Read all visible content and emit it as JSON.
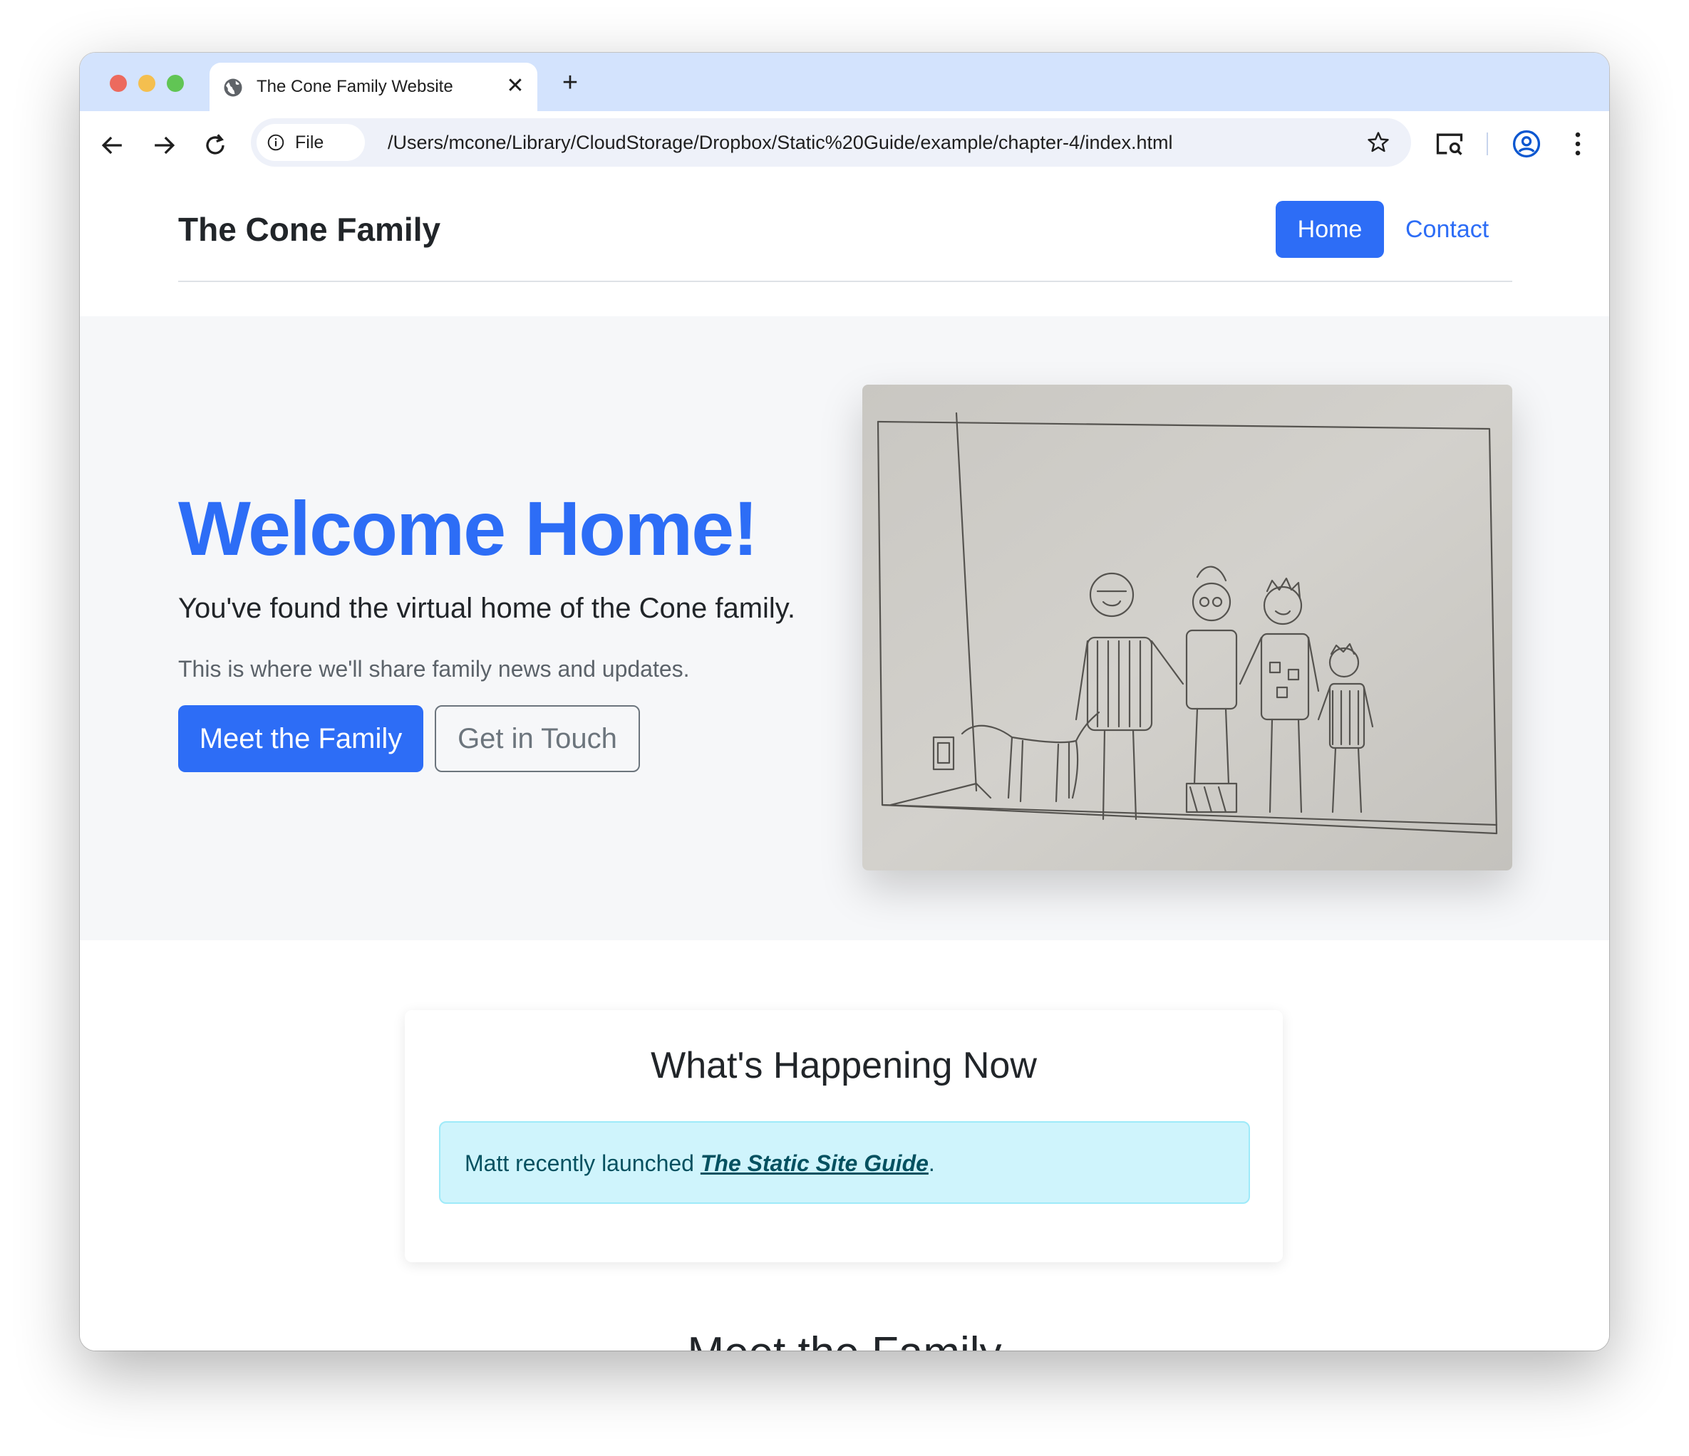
{
  "browser": {
    "tab_title": "The Cone Family Website",
    "site_chip_label": "File",
    "url": "/Users/mcone/Library/CloudStorage/Dropbox/Static%20Guide/example/chapter-4/index.html",
    "tab_close_symbol": "✕",
    "new_tab_symbol": "+"
  },
  "navbar": {
    "brand": "The Cone Family",
    "links": [
      {
        "label": "Home",
        "active": true
      },
      {
        "label": "Contact",
        "active": false
      }
    ]
  },
  "hero": {
    "title": "Welcome Home!",
    "lead": "You've found the virtual home of the Cone family.",
    "subtext": "This is where we'll share family news and updates.",
    "primary_button": "Meet the Family",
    "secondary_button": "Get in Touch"
  },
  "news": {
    "title": "What's Happening Now",
    "alert_prefix": "Matt recently launched ",
    "alert_link": "The Static Site Guide",
    "alert_suffix": "."
  },
  "next_section": {
    "title": "Meet the Family"
  },
  "colors": {
    "accent": "#2d6df6",
    "tabstrip": "#d3e3fd",
    "alert_bg": "#cff4fc",
    "alert_text": "#055160"
  }
}
